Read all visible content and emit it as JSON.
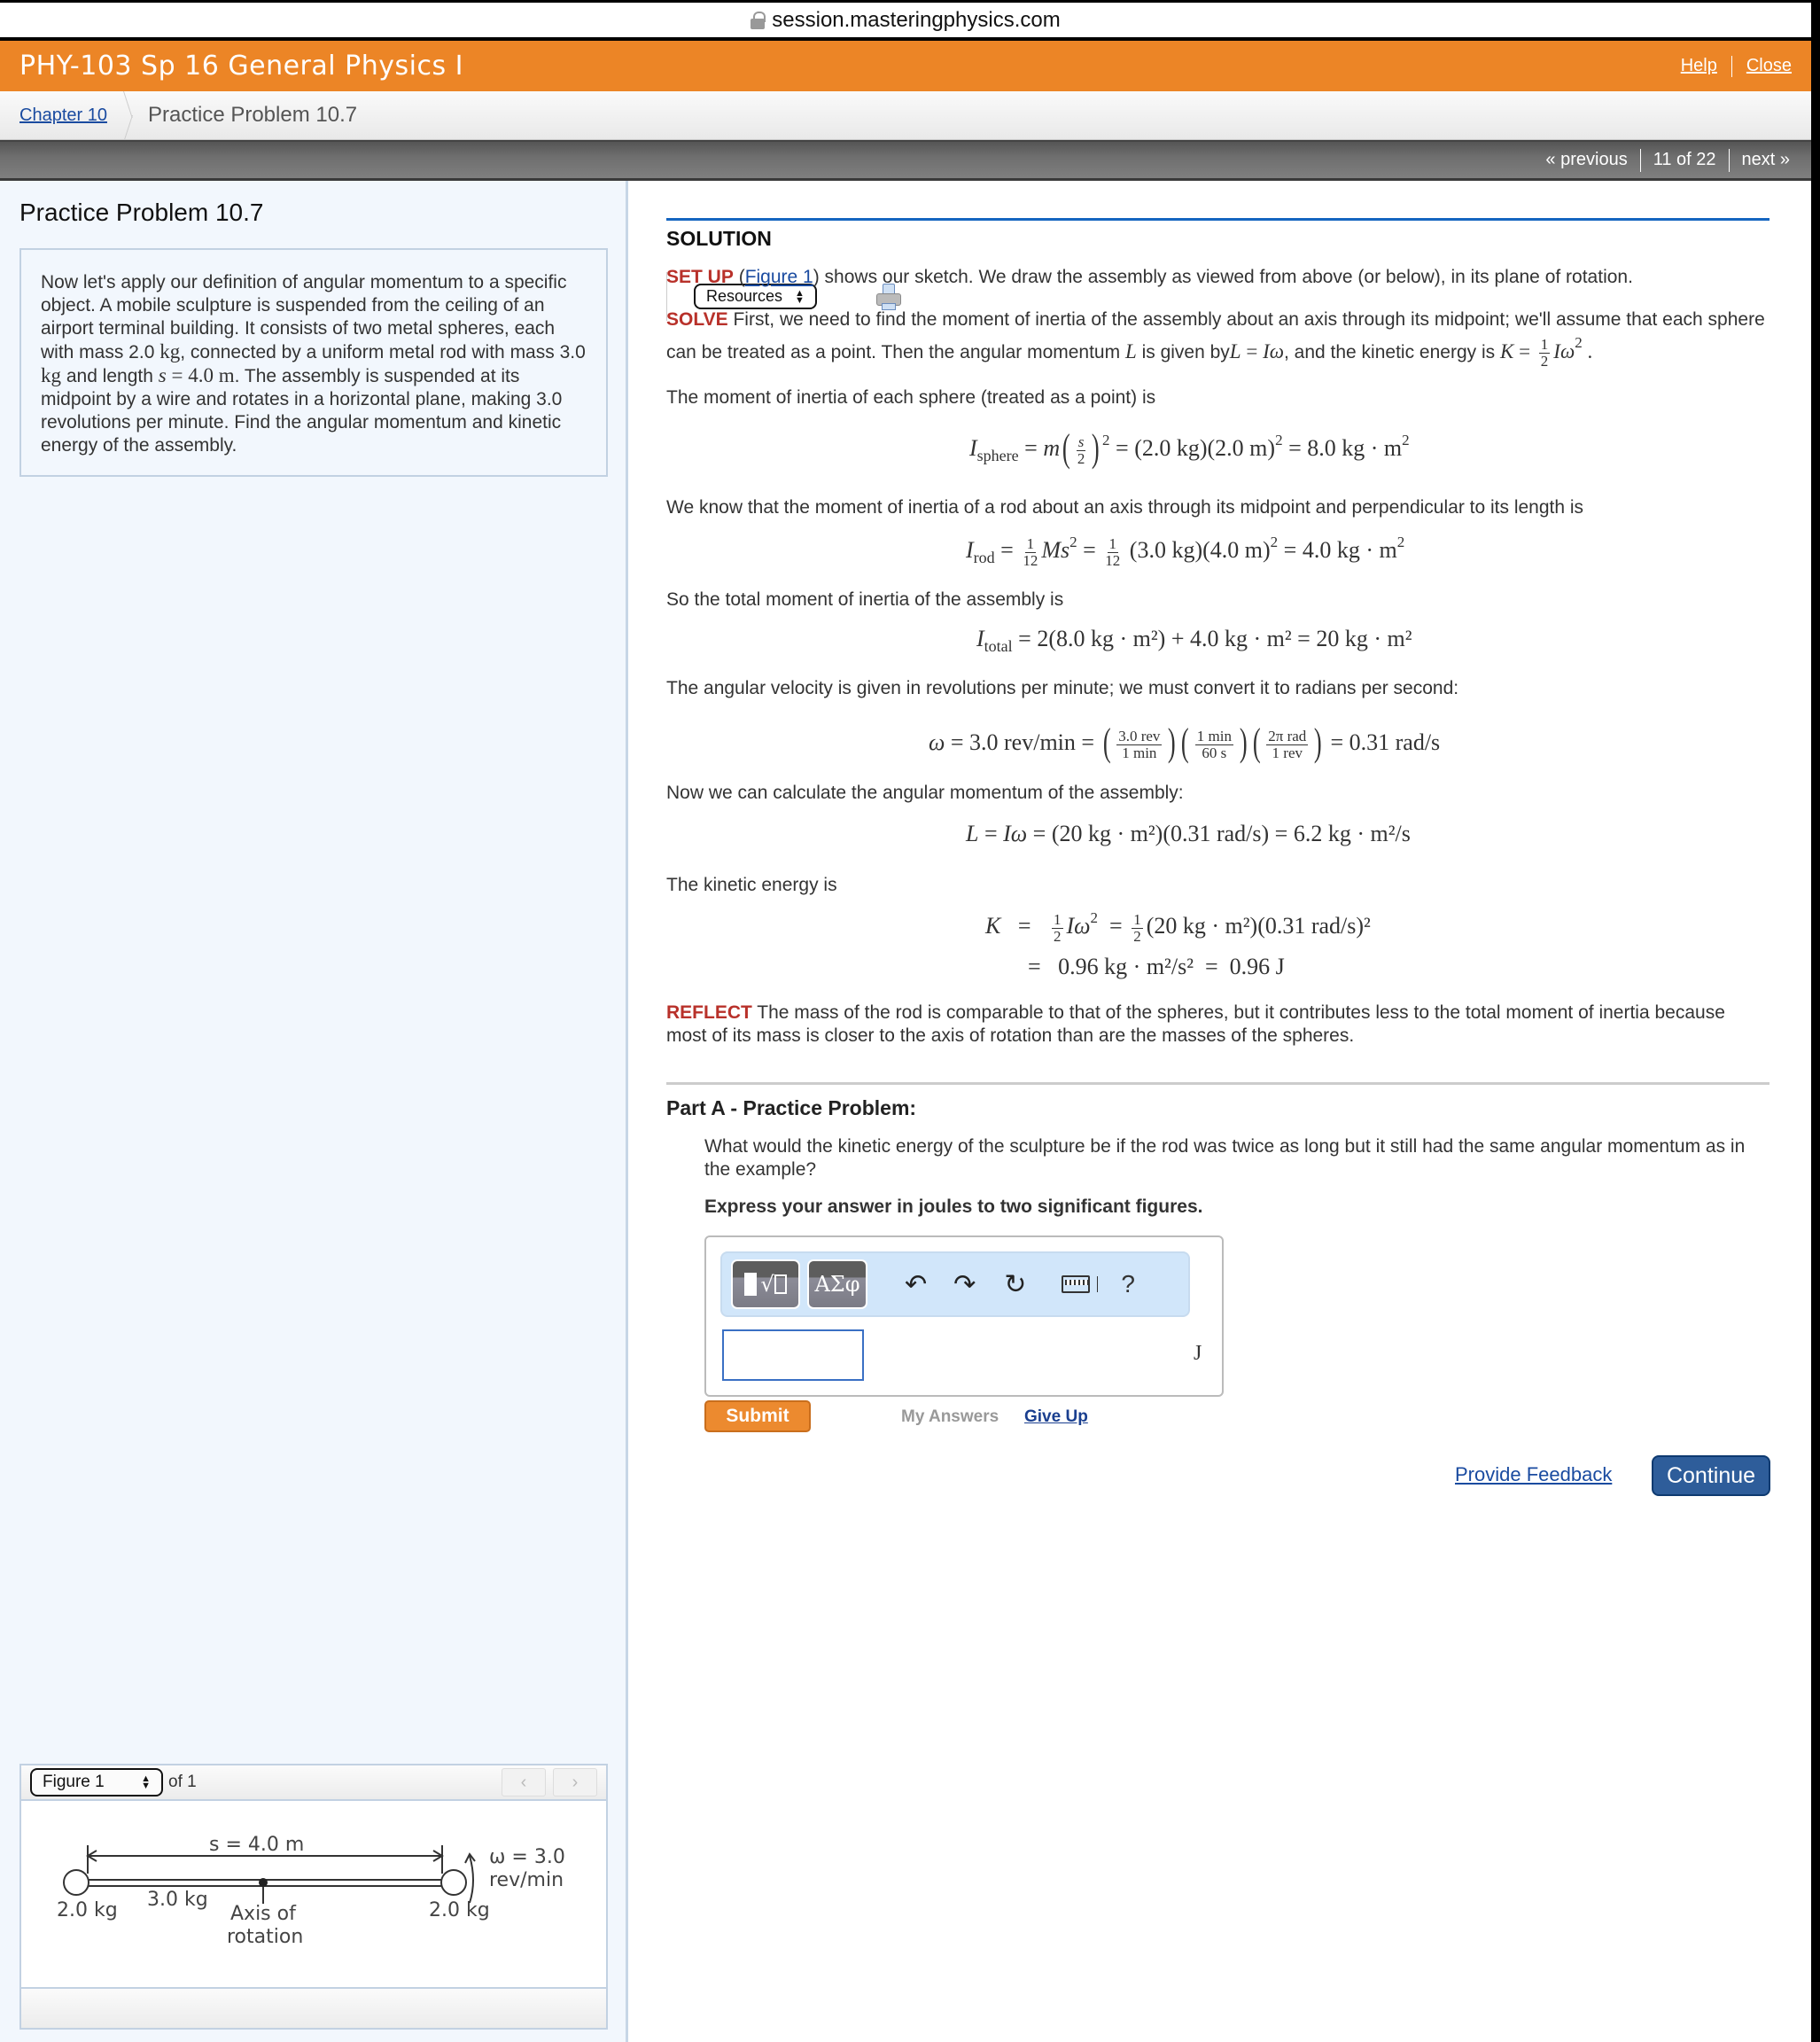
{
  "browser": {
    "url": "session.masteringphysics.com"
  },
  "header": {
    "course_title": "PHY-103 Sp 16 General Physics I",
    "help_label": "Help",
    "close_label": "Close"
  },
  "breadcrumb": {
    "chapter_label": "Chapter 10",
    "current_label": "Practice Problem 10.7",
    "resources_label": "Resources"
  },
  "nav": {
    "previous_label": "« previous",
    "position": "11 of 22",
    "next_label": "next »"
  },
  "left": {
    "title": "Practice Problem 10.7",
    "problem_parts": {
      "t1": "Now let's apply our definition of angular momentum to a specific object. A mobile sculpture is suspended from the ceiling of an airport terminal building. It consists of two metal spheres, each with mass 2.0 ",
      "u1": "kg",
      "t2": ", connected by a uniform metal rod with mass 3.0 ",
      "u2": "kg",
      "t3": " and length ",
      "var_s": "s",
      "eq": " = 4.0 m",
      "t4": ". The assembly is suspended at its midpoint by a wire and rotates in a horizontal plane, making 3.0 revolutions per minute. Find the angular momentum and kinetic energy of the assembly."
    },
    "figure": {
      "select_label": "Figure 1",
      "of_label": "of 1",
      "prev_icon": "‹",
      "next_icon": "›",
      "labels": {
        "length": "s = 4.0 m",
        "omega1": "ω = 3.0",
        "omega2": "rev/min",
        "mass_left": "2.0 kg",
        "mass_right": "2.0 kg",
        "mass_rod": "3.0 kg",
        "axis1": "Axis of",
        "axis2": "rotation"
      }
    }
  },
  "solution": {
    "heading": "SOLUTION",
    "setup_label": "SET UP",
    "setup_link": "Figure 1",
    "setup_text": ") shows our sketch. We draw the assembly as viewed from above (or below), in its plane of rotation.",
    "solve_label": "SOLVE",
    "solve_text1": " First, we need to find the moment of inertia of the assembly about an axis through its midpoint; we'll assume that each sphere can be treated as a point. Then the angular momentum ",
    "solve_text2": " is given by",
    "solve_text3": ", and the kinetic energy is ",
    "sphere_intro": "The moment of inertia of each sphere (treated as a point) is",
    "eq_sphere_rhs": "= (2.0 kg)(2.0 m)",
    "eq_sphere_end": "= 8.0 kg · m",
    "rod_intro": "We know that the moment of inertia of a rod about an axis through its midpoint and perpendicular to its length is",
    "eq_rod_mid": "(3.0 kg)(4.0 m)",
    "eq_rod_end": "= 4.0 kg · m",
    "total_intro": "So the total moment of inertia of the assembly is",
    "eq_total": "= 2(8.0 kg · m²) + 4.0 kg · m² = 20 kg · m²",
    "omega_intro": "The angular velocity is given in revolutions per minute; we must convert it to radians per second:",
    "eq_omega_lhs": "= 3.0 rev/min =",
    "eq_omega_rhs": "= 0.31 rad/s",
    "omega_fracs": [
      {
        "num": "3.0 rev",
        "den": "1 min"
      },
      {
        "num": "1 min",
        "den": "60 s"
      },
      {
        "num": "2π rad",
        "den": "1 rev"
      }
    ],
    "L_intro": "Now we can calculate the angular momentum of the assembly:",
    "eq_L": "= (20 kg · m²)(0.31 rad/s) = 6.2 kg · m²/s",
    "K_intro": "The kinetic energy is",
    "eq_K1": "(20 kg · m²)(0.31 rad/s)²",
    "eq_K2": "0.96 kg · m²/s²",
    "eq_K3": "0.96 J",
    "reflect_label": "REFLECT",
    "reflect_text": " The mass of the rod is comparable to that of the spheres, but it contributes less to the total moment of inertia because most of its mass is closer to the axis of rotation than are the masses of the spheres."
  },
  "partA": {
    "title": "Part A - Practice Problem:",
    "question": "What would the kinetic energy of the sculpture be if the rod was twice as long but it still had the same angular momentum as in the example?",
    "instruction": "Express your answer in joules to two significant figures.",
    "answer_value": "",
    "unit": "J",
    "toolbar": {
      "templates_label": "√",
      "symbols_label": "ΑΣφ",
      "undo_icon": "↶",
      "redo_icon": "↷",
      "reset_icon": "↻",
      "help_label": "?"
    },
    "submit_label": "Submit",
    "my_answers_label": "My Answers",
    "give_up_label": "Give Up"
  },
  "footer": {
    "feedback_label": "Provide Feedback",
    "continue_label": "Continue"
  }
}
